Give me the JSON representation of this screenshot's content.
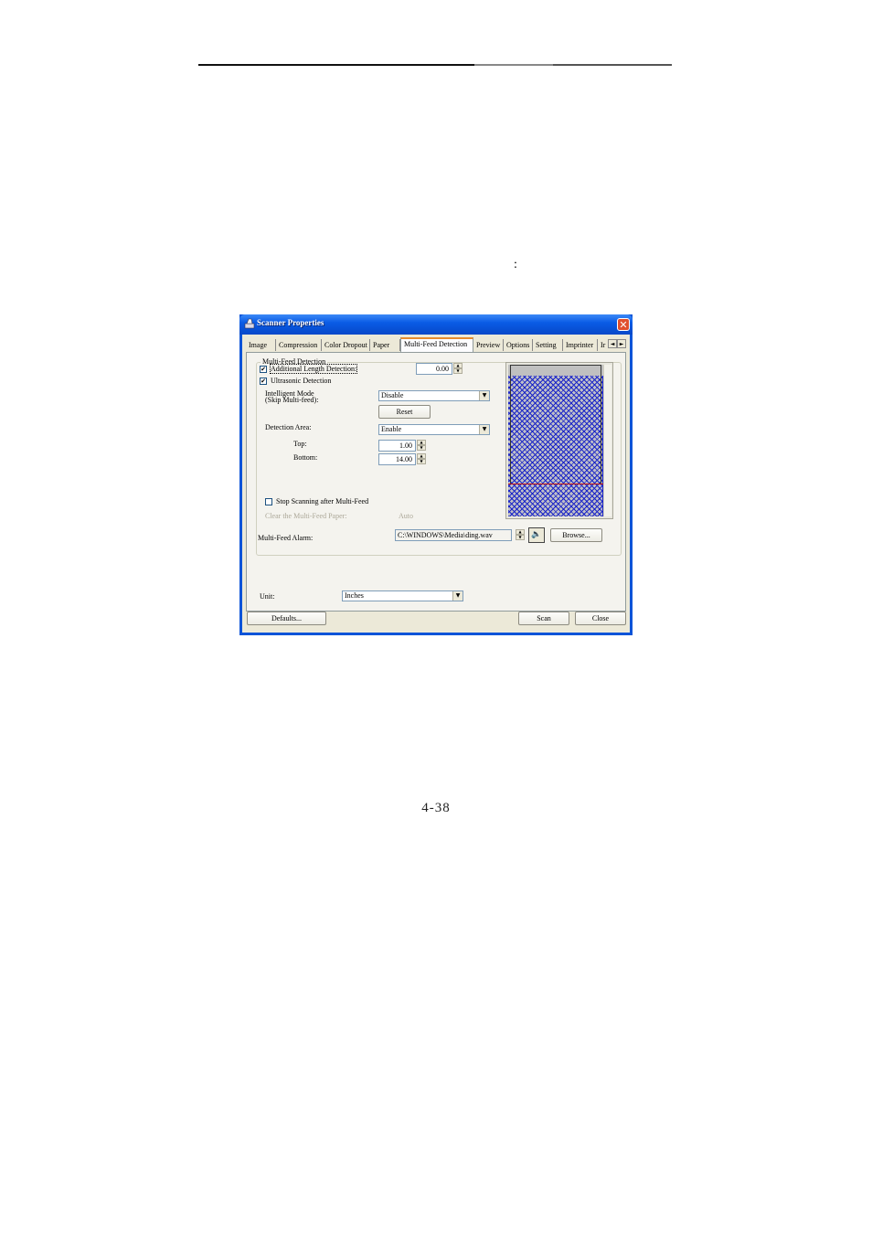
{
  "document": {
    "colon": ":",
    "page_number": "4-38"
  },
  "window": {
    "title": "Scanner Properties",
    "close_glyph": "✕",
    "tabs": [
      {
        "label": "Image"
      },
      {
        "label": "Compression"
      },
      {
        "label": "Color Dropout"
      },
      {
        "label": "Paper"
      },
      {
        "label": "Multi-Feed Detection",
        "active": true
      },
      {
        "label": "Preview"
      },
      {
        "label": "Options"
      },
      {
        "label": "Setting"
      },
      {
        "label": "Imprinter"
      },
      {
        "label": "Ir"
      }
    ],
    "tab_scroll_left": "◄",
    "tab_scroll_right": "►"
  },
  "multifeed": {
    "group_title": "Multi-Feed Detection",
    "additional_length": {
      "label": "Additional Length Detection:",
      "checked": true,
      "value": "0.00"
    },
    "ultrasonic": {
      "label": "Ultrasonic Detection",
      "checked": true
    },
    "intelligent_mode": {
      "label_line1": "Intelligent Mode",
      "label_line2": "(Skip Multi-feed):",
      "value": "Disable"
    },
    "reset_label": "Reset",
    "detection_area": {
      "label": "Detection Area:",
      "value": "Enable"
    },
    "top": {
      "label": "Top:",
      "value": "1.00"
    },
    "bottom": {
      "label": "Bottom:",
      "value": "14.00"
    },
    "stop_scanning": {
      "label": "Stop Scanning after Multi-Feed",
      "checked": false
    },
    "clear_paper": {
      "label": "Clear the Multi-Feed Paper:",
      "value": "Auto"
    },
    "alarm": {
      "label": "Multi-Feed Alarm:",
      "value": "C:\\WINDOWS\\Media\\ding.wav",
      "speaker_glyph": "🔈",
      "browse_label": "Browse..."
    }
  },
  "unit": {
    "label": "Unit:",
    "value": "Inches"
  },
  "buttons": {
    "defaults": "Defaults...",
    "scan": "Scan",
    "close": "Close"
  },
  "glyphs": {
    "check": "✔",
    "dropdown": "▼",
    "spin_up": "▲",
    "spin_down": "▼"
  }
}
